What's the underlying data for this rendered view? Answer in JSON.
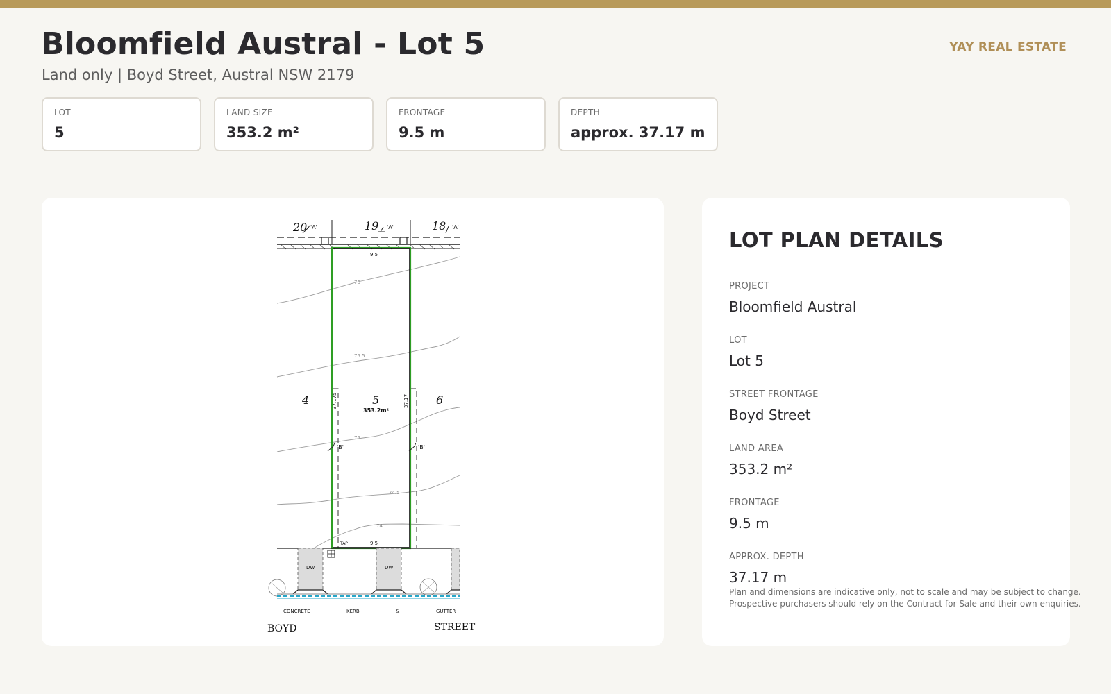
{
  "header": {
    "title": "Bloomfield Austral - Lot 5",
    "subtitle": "Land only | Boyd Street, Austral NSW 2179",
    "brand": "YAY REAL ESTATE"
  },
  "stats": [
    {
      "label": "LOT",
      "value": "5"
    },
    {
      "label": "LAND SIZE",
      "value": "353.2 m²"
    },
    {
      "label": "FRONTAGE",
      "value": "9.5 m"
    },
    {
      "label": "DEPTH",
      "value": "approx. 37.17 m"
    }
  ],
  "plan": {
    "lots_top": [
      "20",
      "19",
      "18"
    ],
    "marker_a": "'A'",
    "marker_b": "'B'",
    "lot_left": "4",
    "lot_center": "5",
    "lot_right": "6",
    "area": "353.2m²",
    "frontage_top": "9.5",
    "frontage_bottom": "9.5",
    "depth_left": "37.175",
    "depth_right": "37.17",
    "contours": [
      "76",
      "75.5",
      "75",
      "74.5",
      "74"
    ],
    "tap": "TAP",
    "driveway": "DW",
    "kerb_words": [
      "CONCRETE",
      "KERB",
      "&",
      "GUTTER"
    ],
    "street_words": [
      "BOYD",
      "STREET"
    ]
  },
  "details": {
    "title": "LOT PLAN DETAILS",
    "fields": [
      {
        "label": "PROJECT",
        "value": "Bloomfield Austral"
      },
      {
        "label": "LOT",
        "value": "Lot 5"
      },
      {
        "label": "STREET FRONTAGE",
        "value": "Boyd Street"
      },
      {
        "label": "LAND AREA",
        "value": "353.2 m²"
      },
      {
        "label": "FRONTAGE",
        "value": "9.5 m"
      },
      {
        "label": "APPROX. DEPTH",
        "value": "37.17 m"
      }
    ],
    "disclaimer": "Plan and dimensions are indicative only, not to scale and may be subject to change. Prospective purchasers should rely on the Contract for Sale and their own enquiries."
  }
}
